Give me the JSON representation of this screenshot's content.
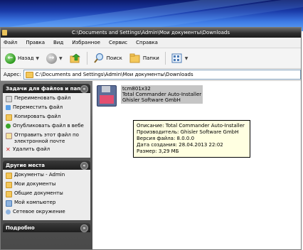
{
  "window": {
    "title": "C:\\Documents and Settings\\Admin\\Мои документы\\Downloads"
  },
  "menu": [
    "Файл",
    "Правка",
    "Вид",
    "Избранное",
    "Сервис",
    "Справка"
  ],
  "toolbar": {
    "back_label": "Назад",
    "search_label": "Поиск",
    "folders_label": "Папки"
  },
  "address": {
    "label": "Адрес:",
    "value": "C:\\Documents and Settings\\Admin\\Мои документы\\Downloads"
  },
  "sidebar": {
    "tasks_title": "Задачи для файлов и папок",
    "tasks": [
      "Переименовать файл",
      "Переместить файл",
      "Копировать файл",
      "Опубликовать файл в вебе",
      "Отправить этот файл по электронной почте",
      "Удалить файл"
    ],
    "places_title": "Другие места",
    "places": [
      "Документы - Admin",
      "Мои документы",
      "Общие документы",
      "Мой компьютер",
      "Сетевое окружение"
    ],
    "details_title": "Подробно"
  },
  "file": {
    "name": "tcm801x32",
    "description": "Total Commander Auto-Installer",
    "company": "Ghisler Software GmbH"
  },
  "tooltip": {
    "line1": "Описание: Total Commander Auto-Installer",
    "line2": "Производитель: Ghisler Software GmbH",
    "line3": "Версия файла: 8.0.0.0",
    "line4": "Дата создания: 28.04.2013 22:02",
    "line5": "Размер: 3,29 МБ"
  },
  "colors": {
    "sidebar_bg": "#575757",
    "panel_header": "#1e1e1e",
    "tooltip_bg": "#ffffe1",
    "selection": "#c5c5c5"
  }
}
